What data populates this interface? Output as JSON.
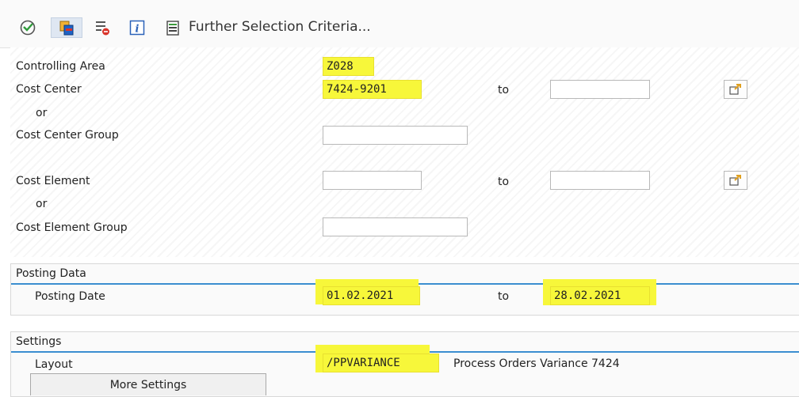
{
  "toolbar": {
    "execute_icon": "execute-icon",
    "copy_icon": "copy-icon",
    "delete_icon": "delete-icon",
    "info_icon": "info-icon",
    "further_label": "Further Selection Criteria..."
  },
  "fields": {
    "controlling_area": {
      "label": "Controlling Area",
      "value": "Z028"
    },
    "cost_center": {
      "label": "Cost Center",
      "from": "7424-9201",
      "to_label": "to",
      "to": ""
    },
    "or1": "or",
    "cost_center_group": {
      "label": "Cost Center Group",
      "value": ""
    },
    "cost_element": {
      "label": "Cost Element",
      "from": "",
      "to_label": "to",
      "to": ""
    },
    "or2": "or",
    "cost_element_group": {
      "label": "Cost Element Group",
      "value": ""
    }
  },
  "posting": {
    "title": "Posting Data",
    "posting_date": {
      "label": "Posting Date",
      "from": "01.02.2021",
      "to_label": "to",
      "to": "28.02.2021"
    }
  },
  "settings": {
    "title": "Settings",
    "layout": {
      "label": "Layout",
      "value": "/PPVARIANCE",
      "description": "Process Orders Variance 7424"
    },
    "more_button": "More Settings"
  },
  "colors": {
    "accent": "#3b8ed0",
    "highlight": "#f7f73a"
  }
}
